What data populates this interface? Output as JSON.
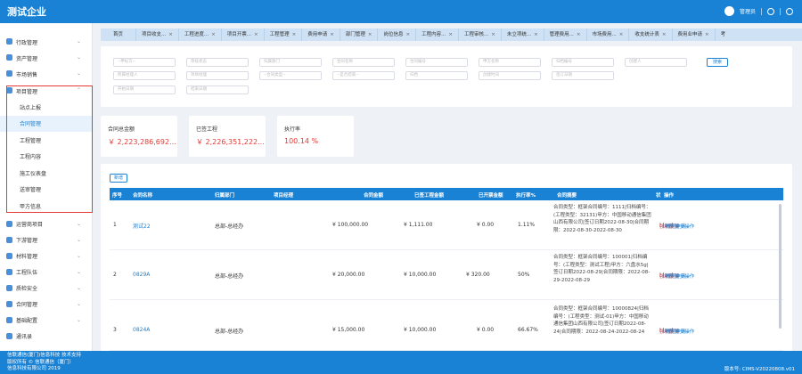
{
  "header": {
    "logo": "测试企业",
    "user": "管理员"
  },
  "sidebar": {
    "top": [
      {
        "label": "行政管理",
        "color": "#4a90d9"
      },
      {
        "label": "资产管理",
        "color": "#4a90d9"
      },
      {
        "label": "市场销售",
        "color": "#4a90d9"
      }
    ],
    "project": {
      "label": "项目管理",
      "color": "#4a90d9"
    },
    "sub": [
      "站点上报",
      "合同管理",
      "工程管理",
      "工程内容",
      "施工仪表盘",
      "送审管理",
      "甲方信息"
    ],
    "bottom": [
      {
        "label": "运营商项目",
        "color": "#4a90d9"
      },
      {
        "label": "下游管理",
        "color": "#4a90d9"
      },
      {
        "label": "材料管理",
        "color": "#4a90d9"
      },
      {
        "label": "工程队伍",
        "color": "#4a90d9"
      },
      {
        "label": "质检安全",
        "color": "#4a90d9"
      },
      {
        "label": "合同管理",
        "color": "#4a90d9"
      },
      {
        "label": "基础配置",
        "color": "#4a90d9"
      },
      {
        "label": "通讯录",
        "color": "#4a90d9"
      }
    ]
  },
  "tabs": [
    "首页",
    "项目收支...",
    "工程进度...",
    "项目开票...",
    "工程管理",
    "费用申请",
    "部门管理",
    "岗位信息",
    "工程内容...",
    "工程审核...",
    "未立项统...",
    "管理费用...",
    "市场费用...",
    "收支统计表",
    "费用业申请",
    "考"
  ],
  "filter": {
    "row1": [
      "--甲标方--",
      "审核状态",
      "归属部门",
      "合同名称",
      "合同编号",
      "甲方名称",
      "归档编号",
      "创建人"
    ],
    "row2": [
      "所属经理人",
      "项目经理",
      "--合同类型--",
      "--是否结束--",
      "归档",
      "创建时间",
      "签订日期"
    ],
    "row3": [
      "开始日期",
      "结束日期"
    ],
    "search": "搜索"
  },
  "stats": [
    {
      "label": "合同总金额",
      "value": "￥ 2,223,286,692..."
    },
    {
      "label": "已签工程",
      "value": "￥ 2,226,351,222..."
    },
    {
      "label": "执行率",
      "value": "100.14 %"
    }
  ],
  "table": {
    "new_label": "新增",
    "headers": [
      "序号",
      "合同名称",
      "归属部门",
      "项目经理",
      "合同金额",
      "已签工程金额",
      "已开票金额",
      "执行率%",
      "合同摘要",
      "状",
      "操作"
    ],
    "rows": [
      {
        "no": "1",
        "name": "测试22",
        "dept": "总部-总经办",
        "amount": "¥ 100,000.00",
        "signed": "¥ 1,111.00",
        "invoiced": "¥ 0.00",
        "rate": "1.11%",
        "summary": "合同类型：框架合同编号：1111|归档编号：(工程类型：32131)甲方：中国移动通信集团山西有限公司|签订日期2022-08-30|合同期限：2022-08-30-2022-08-30"
      },
      {
        "no": "2",
        "name": "0829A",
        "dept": "总部-总经办",
        "amount": "¥ 20,000.00",
        "signed": "¥ 10,000.00",
        "invoiced": "¥ 320.00",
        "rate": "50%",
        "summary": "合同类型：框架合同编号：100001|归档编号：(工程类型：测试工程)甲方：六盘水5g|签订日期2022-08-29|合同期限：2022-08-29-2022-08-29"
      },
      {
        "no": "3",
        "name": "0824A",
        "dept": "总部-总经办",
        "amount": "¥ 15,000.00",
        "signed": "¥ 10,000.00",
        "invoiced": "¥ 0.00",
        "rate": "66.67%",
        "summary": "合同类型：框架合同编号：10000824|归档编号：(工程类型：测试-01)甲方：中国移动通信集团山西有限公司|签订日期2022-08-24|合同期限：2022-08-24-2022-08-24"
      }
    ],
    "ops": {
      "del": "强制删除",
      "detail": "详情",
      "finance": "财务申请",
      "more": "更多操作"
    }
  },
  "footer": {
    "line1": "信联通信(厦门)信息科技 技术支持",
    "line2": "版权所有 © 信联通信（厦门）",
    "line3": "信息科技有限公司 2019",
    "version": "版本号: CIMS-V20220808.v01"
  }
}
